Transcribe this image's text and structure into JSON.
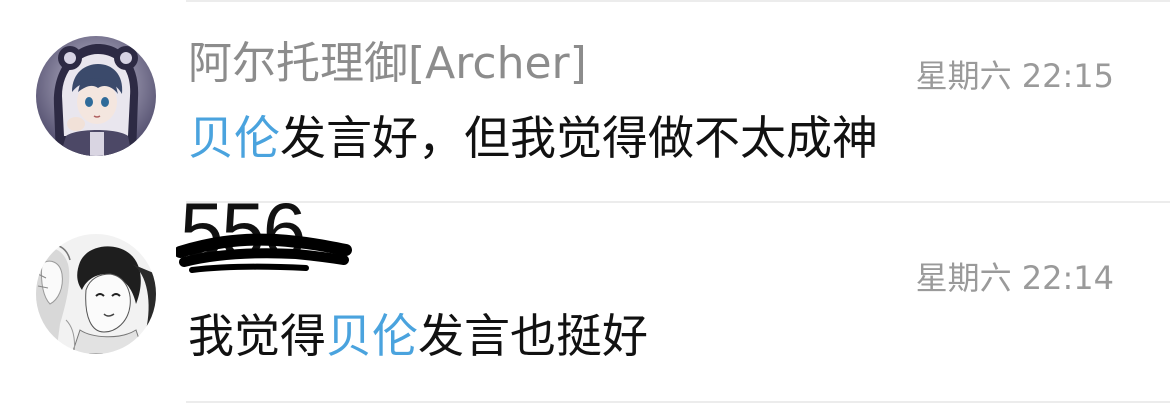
{
  "comments": [
    {
      "username": "阿尔托理御[Archer]",
      "timestamp": "星期六 22:15",
      "mention": "贝伦",
      "text": "发言好，但我觉得做不太成神",
      "avatar_icon": "anime-avatar-hooded-boy-icon"
    },
    {
      "username": "556",
      "timestamp": "星期六 22:14",
      "text_before": "我觉得",
      "mention": "贝伦",
      "text_after": "发言也挺好",
      "avatar_icon": "anime-avatar-manga-girls-icon"
    }
  ],
  "colors": {
    "mention": "#4aa3de",
    "username": "#8c8c8c",
    "timestamp": "#9a9a9a",
    "body": "#111111",
    "divider": "#ececec"
  }
}
